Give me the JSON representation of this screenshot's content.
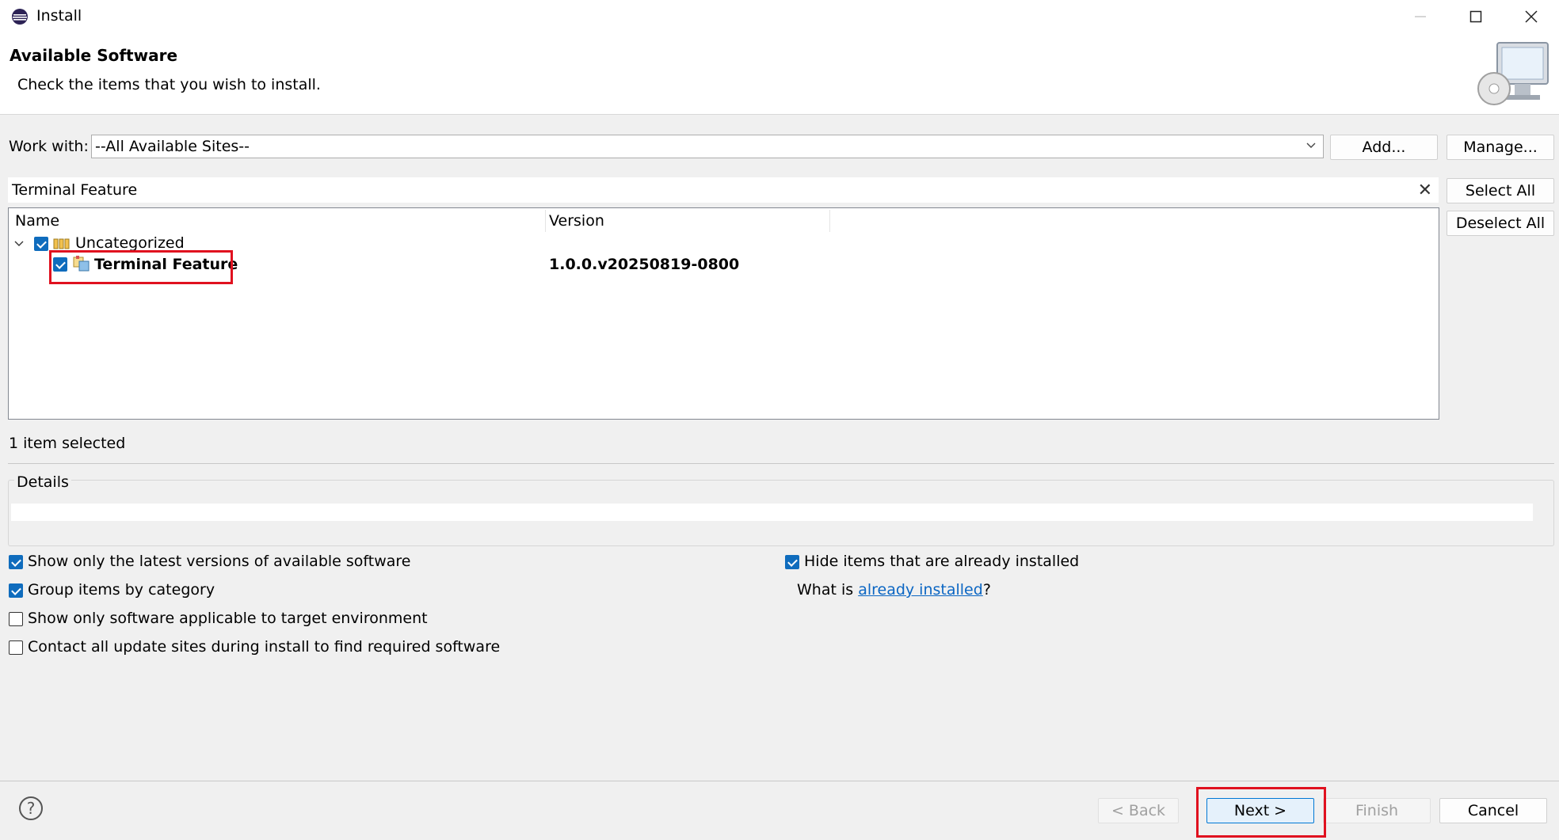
{
  "window": {
    "title": "Install"
  },
  "header": {
    "title": "Available Software",
    "subtitle": "Check the items that you wish to install."
  },
  "work_with": {
    "label": "Work with:",
    "value": "--All Available Sites--",
    "add_label": "Add...",
    "manage_label": "Manage..."
  },
  "filter": {
    "value": "Terminal Feature",
    "select_all_label": "Select All",
    "deselect_all_label": "Deselect All"
  },
  "tree": {
    "columns": [
      "Name",
      "Version"
    ],
    "rows": [
      {
        "name": "Uncategorized",
        "version": "",
        "checked": true,
        "expanded": true
      },
      {
        "name": "Terminal Feature",
        "version": "1.0.0.v20250819-0800",
        "checked": true
      }
    ]
  },
  "status": "1 item selected",
  "details": {
    "label": "Details"
  },
  "options": {
    "latest_versions": {
      "label": "Show only the latest versions of available software",
      "checked": true
    },
    "group_by_category": {
      "label": "Group items by category",
      "checked": true
    },
    "target_env": {
      "label": "Show only software applicable to target environment",
      "checked": false
    },
    "contact_sites": {
      "label": "Contact all update sites during install to find required software",
      "checked": false
    },
    "hide_installed": {
      "label": "Hide items that are already installed",
      "checked": true
    },
    "what_is_prefix": "What is ",
    "what_is_link": "already installed",
    "what_is_suffix": "?"
  },
  "buttons": {
    "help": "?",
    "back": "< Back",
    "next": "Next >",
    "finish": "Finish",
    "cancel": "Cancel"
  },
  "colors": {
    "accent": "#0f6cbd",
    "highlight": "#e0111f",
    "link": "#0b66c3"
  }
}
